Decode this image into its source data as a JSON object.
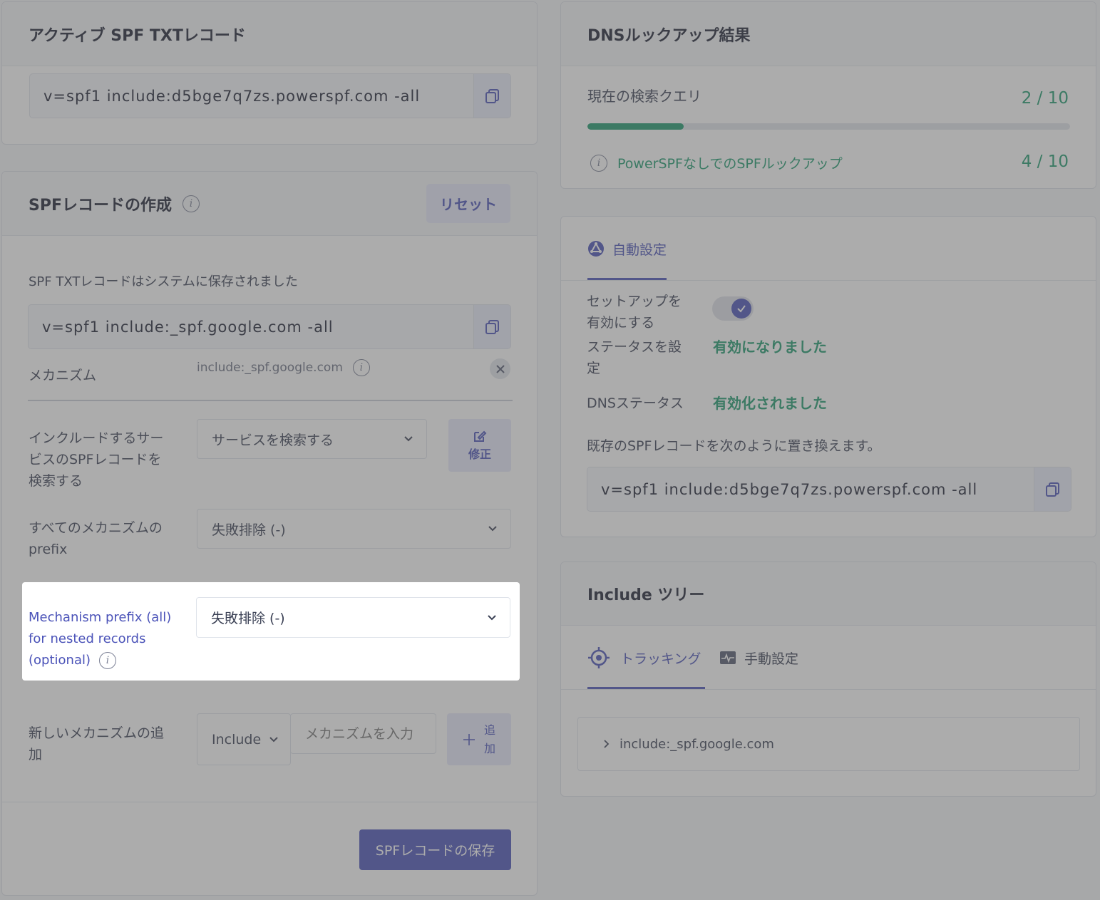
{
  "active_record": {
    "title": "アクティブ SPF TXTレコード",
    "value": "v=spf1 include:d5bge7q7zs.powerspf.com -all"
  },
  "builder": {
    "title": "SPFレコードの作成",
    "reset_label": "リセット",
    "saved_note": "SPF TXTレコードはシステムに保存されました",
    "saved_value": "v=spf1 include:_spf.google.com -all",
    "mechanism_label": "メカニズム",
    "mechanism_value": "include:_spf.google.com",
    "search_label_1": "インクルードするサー",
    "search_label_2": "ビスのSPFレコードを",
    "search_label_3": "検索する",
    "search_placeholder": "サービスを検索する",
    "edit_label": "修正",
    "all_prefix_label_1": "すべてのメカニズムの",
    "all_prefix_label_2": "prefix",
    "all_prefix_value": "失敗排除 (-)",
    "nested_label_1": "Mechanism prefix (all)",
    "nested_label_2": "for nested records",
    "nested_label_3": "(optional)",
    "nested_value": "失敗排除 (-)",
    "add_label_1": "新しいメカニズムの追",
    "add_label_2": "加",
    "add_type": "Include",
    "add_placeholder": "メカニズムを入力",
    "add_btn_1": "追",
    "add_btn_2": "加",
    "save_label": "SPFレコードの保存"
  },
  "lookup": {
    "title": "DNSルックアップ結果",
    "current_label": "現在の検索クエリ",
    "current_count": "2 / 10",
    "current_progress": 0.2,
    "without_label": "PowerSPFなしでのSPFルックアップ",
    "without_count": "4 / 10"
  },
  "auto": {
    "tab_label": "自動設定",
    "setup_label_1": "セットアップを",
    "setup_label_2": "有効にする",
    "setup_enabled": true,
    "status_label_1": "ステータスを設",
    "status_label_2": "定",
    "status_value": "有効になりました",
    "dns_label": "DNSステータス",
    "dns_value": "有効化されました",
    "replace_note": "既存のSPFレコードを次のように置き換えます。",
    "replace_value": "v=spf1 include:d5bge7q7zs.powerspf.com -all"
  },
  "tree": {
    "title": "Include ツリー",
    "tab_tracking": "トラッキング",
    "tab_manual": "手動設定",
    "root_item": "include:_spf.google.com"
  },
  "colors": {
    "accent": "#4a52b8",
    "green": "#1f9a6e",
    "overlay": "rgba(90,90,90,0.5)"
  }
}
